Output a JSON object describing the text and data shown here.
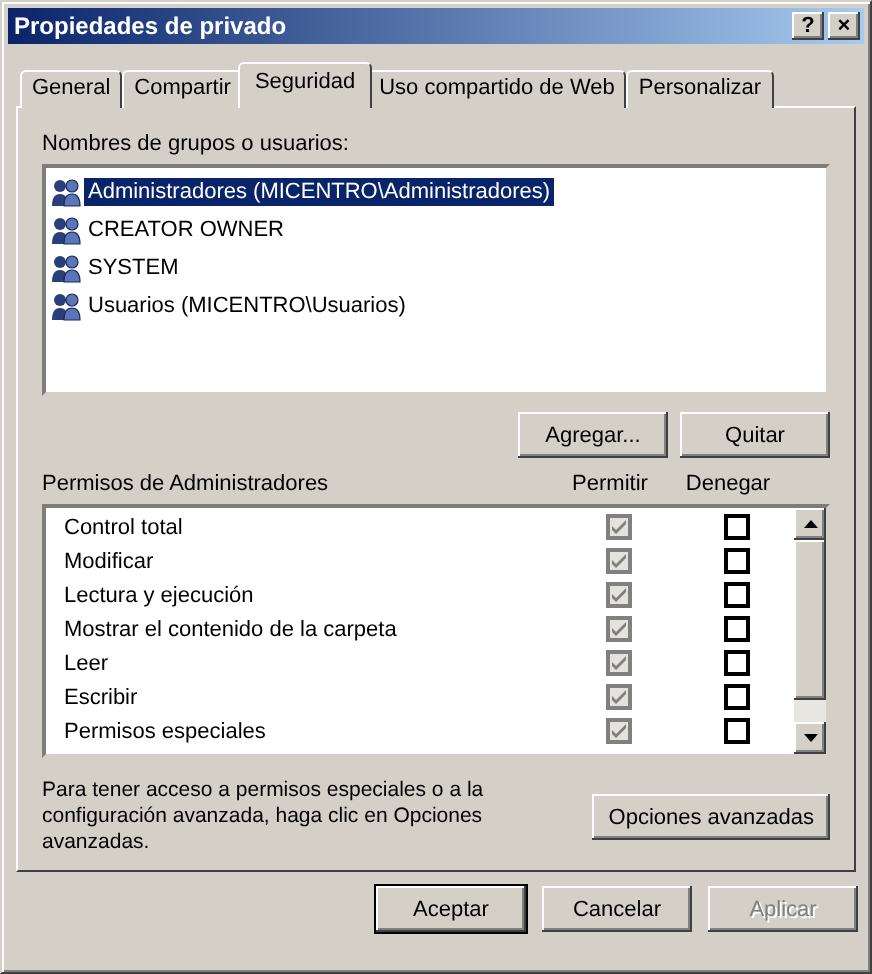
{
  "window": {
    "title": "Propiedades de privado",
    "title_buttons": [
      "?",
      "×"
    ]
  },
  "tabs": [
    {
      "label": "General",
      "selected": false
    },
    {
      "label": "Compartir",
      "selected": false
    },
    {
      "label": "Seguridad",
      "selected": true
    },
    {
      "label": "Uso compartido de Web",
      "selected": false
    },
    {
      "label": "Personalizar",
      "selected": false
    }
  ],
  "groups": {
    "label": "Nombres de grupos o usuarios:",
    "items": [
      {
        "name": "Administradores (MICENTRO\\Administradores)",
        "selected": true
      },
      {
        "name": "CREATOR OWNER",
        "selected": false
      },
      {
        "name": "SYSTEM",
        "selected": false
      },
      {
        "name": "Usuarios (MICENTRO\\Usuarios)",
        "selected": false
      }
    ],
    "buttons": [
      "Agregar...",
      "Quitar"
    ]
  },
  "permissions": {
    "label": "Permisos de Administradores",
    "columns": [
      "Permitir",
      "Denegar"
    ],
    "rows": [
      {
        "name": "Control total",
        "allow": {
          "checked": true,
          "disabled": true
        },
        "deny": {
          "checked": false,
          "disabled": false
        }
      },
      {
        "name": "Modificar",
        "allow": {
          "checked": true,
          "disabled": true
        },
        "deny": {
          "checked": false,
          "disabled": false
        }
      },
      {
        "name": "Lectura y ejecución",
        "allow": {
          "checked": true,
          "disabled": true
        },
        "deny": {
          "checked": false,
          "disabled": false
        }
      },
      {
        "name": "Mostrar el contenido de la carpeta",
        "allow": {
          "checked": true,
          "disabled": true
        },
        "deny": {
          "checked": false,
          "disabled": false
        }
      },
      {
        "name": "Leer",
        "allow": {
          "checked": true,
          "disabled": true
        },
        "deny": {
          "checked": false,
          "disabled": false
        }
      },
      {
        "name": "Escribir",
        "allow": {
          "checked": true,
          "disabled": true
        },
        "deny": {
          "checked": false,
          "disabled": false
        }
      },
      {
        "name": "Permisos especiales",
        "allow": {
          "checked": true,
          "disabled": true
        },
        "deny": {
          "checked": false,
          "disabled": false
        }
      }
    ]
  },
  "advanced": {
    "text": "Para tener acceso a permisos especiales o a la configuración avanzada, haga clic en Opciones avanzadas.",
    "button": "Opciones avanzadas"
  },
  "buttons": [
    {
      "label": "Aceptar",
      "disabled": false,
      "default": true
    },
    {
      "label": "Cancelar",
      "disabled": false,
      "default": false
    },
    {
      "label": "Aplicar",
      "disabled": true,
      "default": false
    }
  ]
}
